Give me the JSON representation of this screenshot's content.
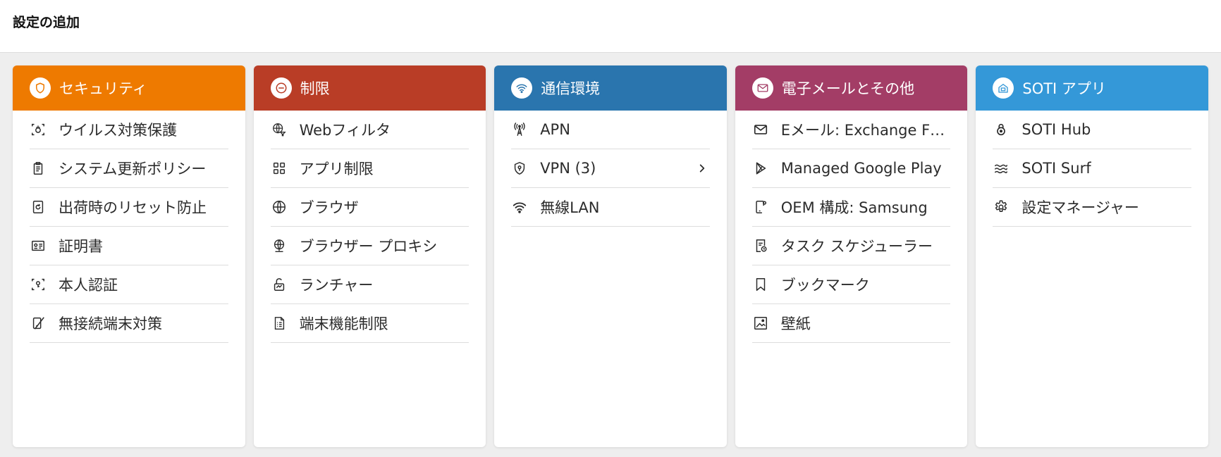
{
  "page_title": "設定の追加",
  "columns": [
    {
      "title": "セキュリティ",
      "color": "#EE7A00",
      "header_icon": "shield-icon",
      "items": [
        {
          "label": "ウイルス対策保護",
          "icon": "virus-scan-icon"
        },
        {
          "label": "システム更新ポリシー",
          "icon": "clipboard-icon"
        },
        {
          "label": "出荷時のリセット防止",
          "icon": "factory-reset-icon"
        },
        {
          "label": "証明書",
          "icon": "certificate-icon"
        },
        {
          "label": "本人認証",
          "icon": "identity-scan-icon"
        },
        {
          "label": "無接続端末対策",
          "icon": "disconnected-device-icon"
        }
      ]
    },
    {
      "title": "制限",
      "color": "#B93D26",
      "header_icon": "minus-circle-icon",
      "items": [
        {
          "label": "Webフィルタ",
          "icon": "web-filter-icon"
        },
        {
          "label": "アプリ制限",
          "icon": "app-grid-icon"
        },
        {
          "label": "ブラウザ",
          "icon": "globe-icon"
        },
        {
          "label": "ブラウザー プロキシ",
          "icon": "proxy-globe-icon"
        },
        {
          "label": "ランチャー",
          "icon": "launcher-icon"
        },
        {
          "label": "端末機能制限",
          "icon": "feature-list-icon"
        }
      ]
    },
    {
      "title": "通信環境",
      "color": "#2A75AE",
      "header_icon": "wifi-icon",
      "items": [
        {
          "label": "APN",
          "icon": "antenna-icon"
        },
        {
          "label": "VPN (3)",
          "icon": "vpn-shield-icon",
          "chevron": true
        },
        {
          "label": "無線LAN",
          "icon": "wifi-icon"
        }
      ]
    },
    {
      "title": "電子メールとその他",
      "color": "#A33D66",
      "header_icon": "mail-icon",
      "items": [
        {
          "label": "Eメール: Exchange F…",
          "icon": "mail-icon"
        },
        {
          "label": "Managed Google Play",
          "icon": "play-icon"
        },
        {
          "label": "OEM 構成: Samsung",
          "icon": "oem-device-icon"
        },
        {
          "label": "タスク スケジューラー",
          "icon": "task-scheduler-icon"
        },
        {
          "label": "ブックマーク",
          "icon": "bookmark-icon"
        },
        {
          "label": "壁紙",
          "icon": "image-icon"
        }
      ]
    },
    {
      "title": "SOTI アプリ",
      "color": "#3498D8",
      "header_icon": "soti-app-icon",
      "items": [
        {
          "label": "SOTI Hub",
          "icon": "soti-hub-icon"
        },
        {
          "label": "SOTI Surf",
          "icon": "soti-surf-icon"
        },
        {
          "label": "設定マネージャー",
          "icon": "gear-icon"
        }
      ]
    }
  ]
}
